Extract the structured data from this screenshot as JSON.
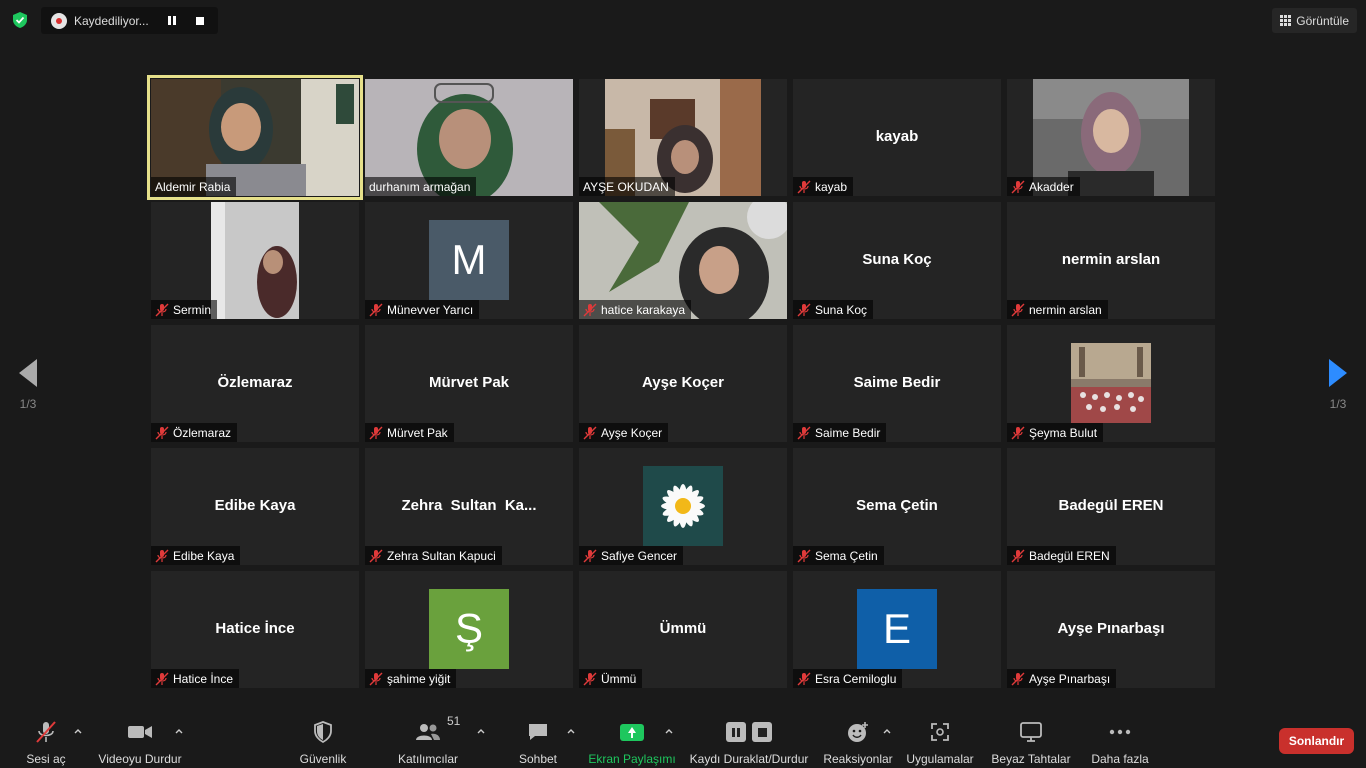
{
  "topbar": {
    "recording_label": "Kaydediliyor...",
    "view_label": "Görüntüle"
  },
  "nav": {
    "prev_page": "1/3",
    "next_page": "1/3"
  },
  "participants": [
    {
      "name": "Aldemir Rabia",
      "video": true,
      "active": true,
      "muted": false
    },
    {
      "name": "durhanım armağan",
      "video": true,
      "muted": false
    },
    {
      "name": "AYŞE OKUDAN",
      "video": true,
      "muted": false
    },
    {
      "name": "kayab",
      "center": "kayab",
      "muted": true
    },
    {
      "name": "Akadder",
      "video": true,
      "muted": true
    },
    {
      "name": "Sermin",
      "video": true,
      "muted": true
    },
    {
      "name": "Münevver Yarıcı",
      "avatar": "M",
      "avatar_color": "#4a5a68",
      "muted": true
    },
    {
      "name": "hatice karakaya",
      "video": true,
      "muted": true
    },
    {
      "name": "Suna Koç",
      "center": "Suna Koç",
      "muted": true
    },
    {
      "name": "nermin arslan",
      "center": "nermin arslan",
      "muted": true
    },
    {
      "name": "Özlemaraz",
      "center": "Özlemaraz",
      "muted": true
    },
    {
      "name": "Mürvet Pak",
      "center": "Mürvet Pak",
      "muted": true
    },
    {
      "name": "Ayşe Koçer",
      "center": "Ayşe Koçer",
      "muted": true
    },
    {
      "name": "Saime Bedir",
      "center": "Saime Bedir",
      "muted": true
    },
    {
      "name": "Şeyma Bulut",
      "photo": "mosque",
      "muted": true
    },
    {
      "name": "Edibe Kaya",
      "center": "Edibe Kaya",
      "muted": true
    },
    {
      "name": "Zehra Sultan Kapuci",
      "center": "Zehra  Sultan  Ka...",
      "muted": true
    },
    {
      "name": "Safiye Gencer",
      "photo": "daisy",
      "muted": true
    },
    {
      "name": "Sema Çetin",
      "center": "Sema Çetin",
      "muted": true
    },
    {
      "name": "Badegül EREN",
      "center": "Badegül EREN",
      "muted": true
    },
    {
      "name": "Hatice İnce",
      "center": "Hatice İnce",
      "muted": true
    },
    {
      "name": "şahime yiğit",
      "avatar": "Ş",
      "avatar_color": "#6aa13d",
      "muted": true
    },
    {
      "name": "Ümmü",
      "center": "Ümmü",
      "muted": true
    },
    {
      "name": "Esra Cemiloglu",
      "avatar": "E",
      "avatar_color": "#0f5fa8",
      "muted": true
    },
    {
      "name": "Ayşe Pınarbaşı",
      "center": "Ayşe Pınarbaşı",
      "muted": true
    }
  ],
  "toolbar": {
    "unmute": "Sesi aç",
    "stop_video": "Videoyu Durdur",
    "security": "Güvenlik",
    "participants": "Katılımcılar",
    "participant_count": "51",
    "chat": "Sohbet",
    "share_screen": "Ekran Paylaşımı",
    "pause_stop_recording": "Kaydı Duraklat/Durdur",
    "reactions": "Reaksiyonlar",
    "apps": "Uygulamalar",
    "whiteboard": "Beyaz Tahtalar",
    "more": "Daha fazla",
    "end": "Sonlandır"
  },
  "colors": {
    "active_speaker": "#e6e08a",
    "share_green": "#1ec75e",
    "end_red": "#c9302c",
    "nav_blue": "#2d8cff"
  }
}
